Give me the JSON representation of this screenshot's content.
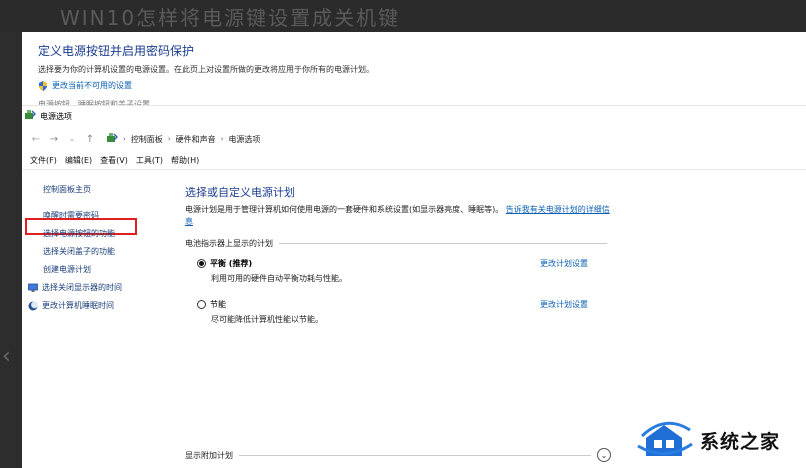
{
  "colors": {
    "accent": "#1a3d8f",
    "link": "#0a5fb4",
    "highlight": "#e02020",
    "background": "#2d2d2d"
  },
  "background_dialog": {
    "title": "定义电源按钮并启用密码保护",
    "description": "选择要为你的计算机设置的电源设置。在此页上对设置所做的更改将应用于你所有的电源计划。",
    "change_link": "更改当前不可用的设置",
    "cut_text": "电源按钮、睡眠按钮和盖子设置"
  },
  "window": {
    "title": "电源选项",
    "breadcrumbs": [
      "控制面板",
      "硬件和声音",
      "电源选项"
    ],
    "menu": [
      "文件(F)",
      "编辑(E)",
      "查看(V)",
      "工具(T)",
      "帮助(H)"
    ]
  },
  "sidebar": {
    "items": [
      {
        "label": "控制面板主页"
      },
      {
        "label": "唤醒时需要密码"
      },
      {
        "label": "选择电源按钮的功能"
      },
      {
        "label": "选择关闭盖子的功能"
      },
      {
        "label": "创建电源计划"
      },
      {
        "label": "选择关闭显示器的时间",
        "icon": "monitor-icon"
      },
      {
        "label": "更改计算机睡眠时间",
        "icon": "moon-icon"
      }
    ]
  },
  "main": {
    "title": "选择或自定义电源计划",
    "description": "电源计划是用于管理计算机如何使用电源的一套硬件和系统设置(如显示器亮度、睡眠等)。",
    "desc_link": "告诉我有关电源计划的详细信息",
    "group_label": "电池指示器上显示的计划",
    "plans": [
      {
        "name": "平衡 (推荐)",
        "desc": "利用可用的硬件自动平衡功耗与性能。",
        "link": "更改计划设置",
        "selected": true
      },
      {
        "name": "节能",
        "desc": "尽可能降低计算机性能以节能。",
        "link": "更改计划设置",
        "selected": false
      }
    ],
    "more_plans": "显示附加计划"
  },
  "watermark": {
    "text": "系统之家"
  }
}
